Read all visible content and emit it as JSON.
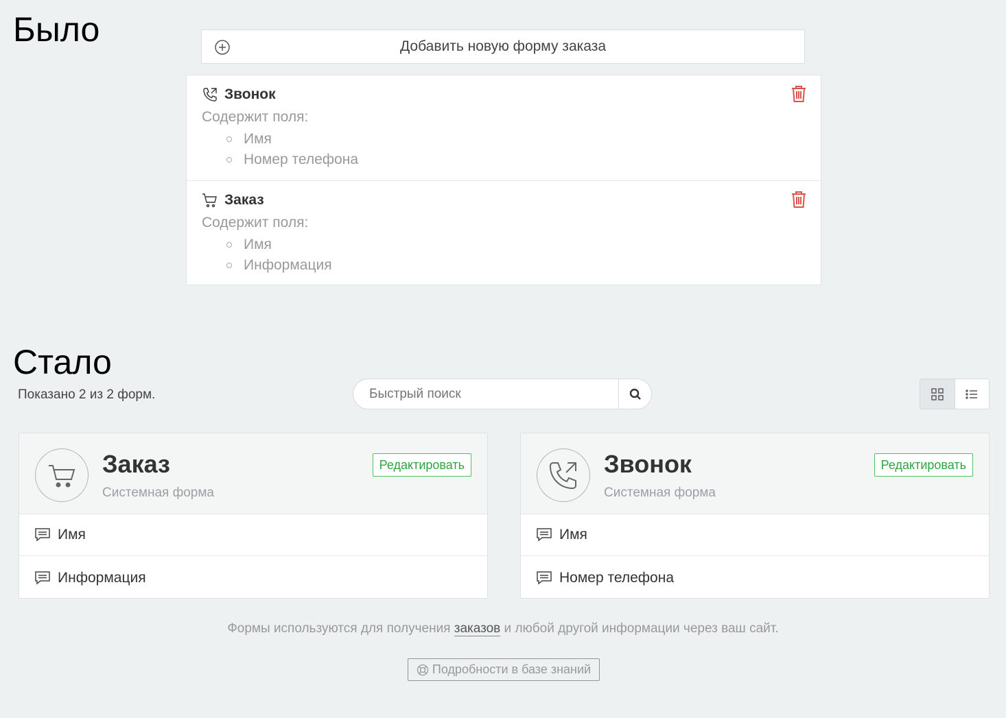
{
  "before": {
    "heading": "Было",
    "add_button_label": "Добавить новую форму заказа",
    "items": [
      {
        "name": "Звонок",
        "contains_label": "Содержит поля:",
        "fields": [
          "Имя",
          "Номер телефона"
        ],
        "icon": "phone-icon"
      },
      {
        "name": "Заказ",
        "contains_label": "Содержит поля:",
        "fields": [
          "Имя",
          "Информация"
        ],
        "icon": "cart-icon"
      }
    ]
  },
  "after": {
    "heading": "Стало",
    "shown_text": "Показано 2 из 2 форм.",
    "search": {
      "placeholder": "Быстрый поиск"
    },
    "cards": [
      {
        "title": "Заказ",
        "subtitle": "Системная форма",
        "edit_label": "Редактировать",
        "icon": "cart-icon",
        "fields": [
          "Имя",
          "Информация"
        ]
      },
      {
        "title": "Звонок",
        "subtitle": "Системная форма",
        "edit_label": "Редактировать",
        "icon": "phone-outgoing-icon",
        "fields": [
          "Имя",
          "Номер телефона"
        ]
      }
    ],
    "footnote": {
      "prefix": "Формы используются для получения ",
      "link": "заказов",
      "suffix": " и любой другой информации через ваш сайт."
    },
    "kb_button_label": "Подробности в базе знаний"
  },
  "colors": {
    "accent_green": "#4cc35e",
    "danger_red": "#d9534f",
    "background": "#eef1f2"
  }
}
